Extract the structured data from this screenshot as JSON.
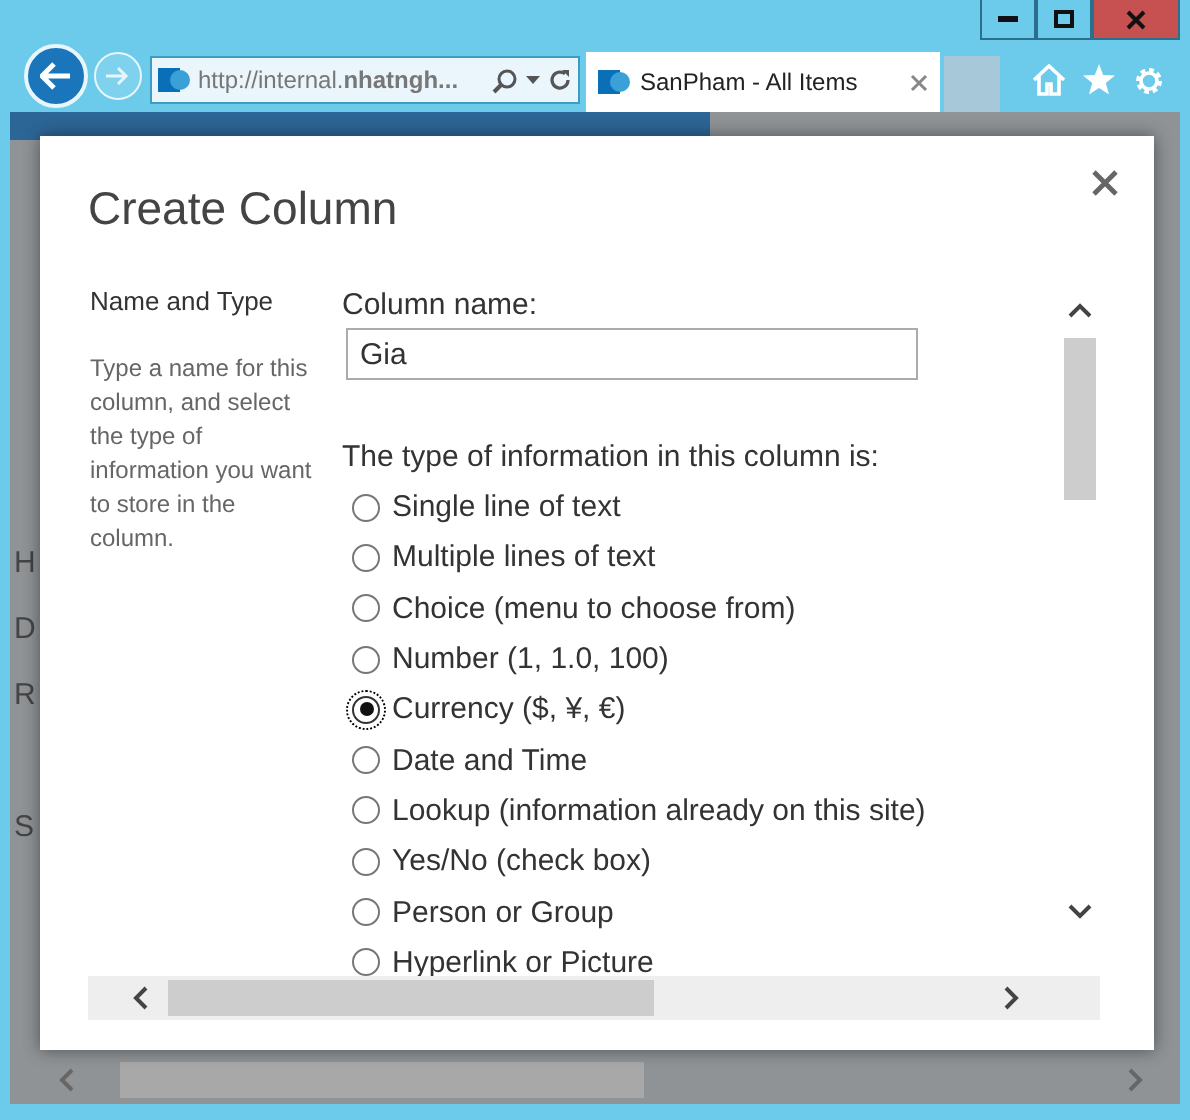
{
  "browser": {
    "address": "http://internal.**nhatngh...**",
    "tabs": [
      {
        "label": "SanPham - All Items",
        "selected": true
      }
    ]
  },
  "page_fragments": [
    "H",
    "D",
    "R",
    "S"
  ],
  "dialog": {
    "title": "Create Column",
    "section": {
      "title": "Name and Type",
      "description": "Type a name for this column, and select the type of information you want to store in the column."
    },
    "column_name": {
      "label": "Column name:",
      "value": "Gia"
    },
    "type": {
      "label": "The type of information in this column is:",
      "options": [
        {
          "label": "Single line of text",
          "selected": false
        },
        {
          "label": "Multiple lines of text",
          "selected": false
        },
        {
          "label": "Choice (menu to choose from)",
          "selected": false
        },
        {
          "label": "Number (1, 1.0, 100)",
          "selected": false
        },
        {
          "label": "Currency ($, ¥, €)",
          "selected": true
        },
        {
          "label": "Date and Time",
          "selected": false
        },
        {
          "label": "Lookup (information already on this site)",
          "selected": false
        },
        {
          "label": "Yes/No (check box)",
          "selected": false
        },
        {
          "label": "Person or Group",
          "selected": false
        },
        {
          "label": "Hyperlink or Picture",
          "selected": false
        }
      ]
    }
  }
}
